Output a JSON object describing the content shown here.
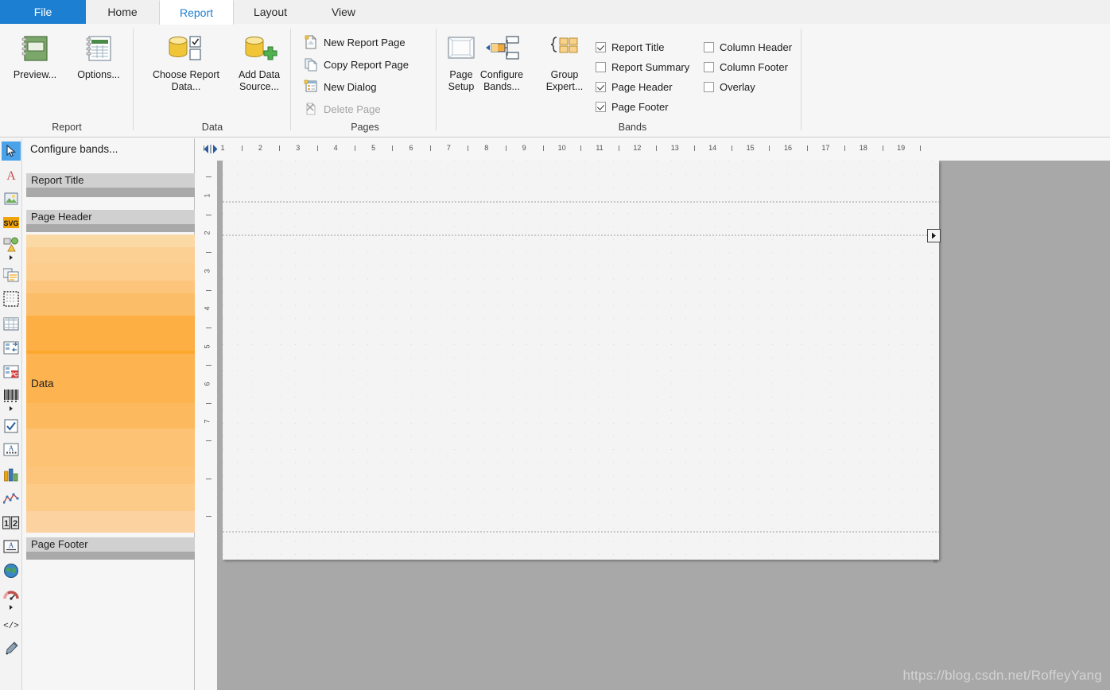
{
  "tabs": [
    {
      "label": "File",
      "state": "file"
    },
    {
      "label": "Home",
      "state": "normal"
    },
    {
      "label": "Report",
      "state": "active"
    },
    {
      "label": "Layout",
      "state": "normal"
    },
    {
      "label": "View",
      "state": "normal"
    }
  ],
  "ribbon": {
    "groups": [
      {
        "name": "Report",
        "label": "Report"
      },
      {
        "name": "Data",
        "label": "Data"
      },
      {
        "name": "Pages",
        "label": "Pages"
      },
      {
        "name": "Bands",
        "label": "Bands"
      }
    ],
    "report_group": {
      "preview": "Preview...",
      "options": "Options..."
    },
    "data_group": {
      "choose_report_data_line1": "Choose Report",
      "choose_report_data_line2": "Data...",
      "add_data_source_line1": "Add Data",
      "add_data_source_line2": "Source..."
    },
    "pages_group": {
      "new_report_page": "New Report Page",
      "copy_report_page": "Copy Report Page",
      "new_dialog": "New Dialog",
      "delete_page": "Delete Page",
      "page_setup_line1": "Page",
      "page_setup_line2": "Setup"
    },
    "bands_group": {
      "configure_bands_line1": "Configure",
      "configure_bands_line2": "Bands...",
      "group_expert_line1": "Group",
      "group_expert_line2": "Expert...",
      "checkboxes": [
        {
          "label": "Report Title",
          "checked": true
        },
        {
          "label": "Report Summary",
          "checked": false
        },
        {
          "label": "Page Header",
          "checked": true
        },
        {
          "label": "Page Footer",
          "checked": true
        },
        {
          "label": "Column Header",
          "checked": false
        },
        {
          "label": "Column Footer",
          "checked": false
        },
        {
          "label": "Overlay",
          "checked": false
        }
      ]
    }
  },
  "toolstrip": {
    "items": [
      {
        "icon": "pointer-icon",
        "selected": true
      },
      {
        "icon": "text-icon",
        "selected": false
      },
      {
        "icon": "picture-icon",
        "selected": false
      },
      {
        "icon": "svg-icon",
        "selected": false
      },
      {
        "icon": "shape-icon",
        "selected": false
      },
      {
        "icon": "shape-dropdown-icon",
        "selected": false
      },
      {
        "icon": "rich-text-icon",
        "selected": false
      },
      {
        "icon": "subreport-icon",
        "selected": false
      },
      {
        "icon": "table-icon",
        "selected": false
      },
      {
        "icon": "crosstab-icon",
        "selected": false
      },
      {
        "icon": "pdf-content-icon",
        "selected": false
      },
      {
        "icon": "barcode-icon",
        "selected": false
      },
      {
        "icon": "barcode-dropdown-icon",
        "selected": false
      },
      {
        "icon": "checkbox-icon",
        "selected": false
      },
      {
        "icon": "zipcode-icon",
        "selected": false
      },
      {
        "icon": "chart-icon",
        "selected": false
      },
      {
        "icon": "sparkline-icon",
        "selected": false
      },
      {
        "icon": "page-number-icon",
        "selected": false
      },
      {
        "icon": "page-info-icon",
        "selected": false
      },
      {
        "icon": "map-icon",
        "selected": false
      },
      {
        "icon": "gauge-icon",
        "selected": false
      },
      {
        "icon": "gauge-dropdown-icon",
        "selected": false
      },
      {
        "icon": "code-icon",
        "selected": false
      },
      {
        "icon": "signature-icon",
        "selected": false
      }
    ]
  },
  "bandpanel": {
    "configure_bands_link": "Configure bands...",
    "bands": [
      {
        "name": "Report Title"
      },
      {
        "name": "Page Header"
      },
      {
        "name": "Data"
      },
      {
        "name": "Page Footer"
      }
    ],
    "data_stripes": [
      "#fbd9a5",
      "#fccf93",
      "#fdcd8e",
      "#fdc57c",
      "#fcbd68",
      "#fdaf43",
      "#fca72e",
      "#fdb450",
      "#fdb95e",
      "#fdc274",
      "#fdc57c",
      "#fbcb87",
      "#fbd2a0"
    ]
  },
  "rulers": {
    "horizontal_ticks": [
      "1",
      "2",
      "3",
      "4",
      "5",
      "6",
      "7",
      "8",
      "9",
      "10",
      "11",
      "12",
      "13",
      "14",
      "15",
      "16",
      "17",
      "18",
      "19"
    ],
    "vertical_ticks": [
      "1",
      "2",
      "3",
      "4",
      "5",
      "6",
      "7"
    ],
    "unit": "cm"
  },
  "canvas": {
    "expand_arrow": "▶",
    "band_separator_count": 3
  },
  "watermark": "https://blog.csdn.net/RoffeyYang",
  "colors": {
    "file_tab": "#1d7fd1",
    "accent": "#1d7fd1",
    "band_header": "#d0d0d0",
    "band_body": "#a9a9a9",
    "canvas_background": "#a8a8a8",
    "page": "#f4f4f4"
  }
}
